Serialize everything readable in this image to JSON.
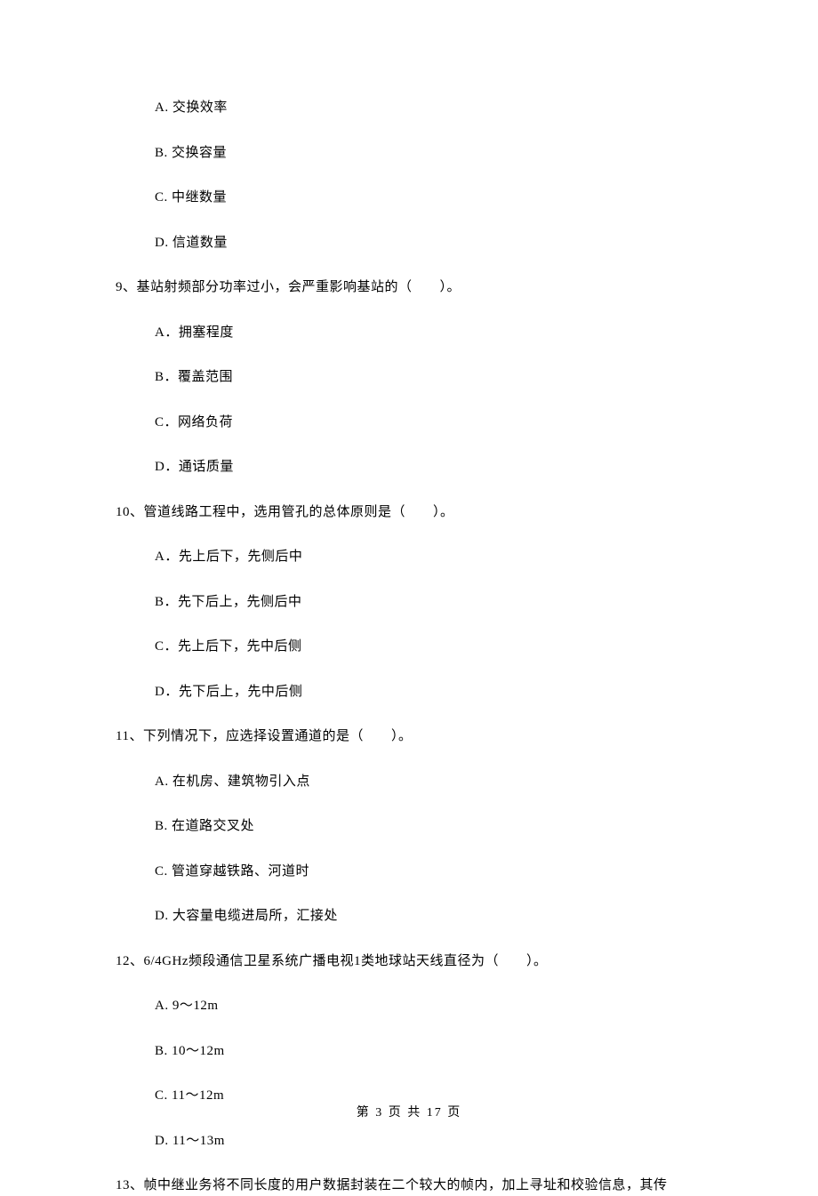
{
  "options_a": {
    "a": "A. 交换效率",
    "b": "B. 交换容量",
    "c": "C. 中继数量",
    "d": "D. 信道数量"
  },
  "q9": {
    "text": "9、基站射频部分功率过小，会严重影响基站的（　　）。",
    "a": "A．拥塞程度",
    "b": "B．覆盖范围",
    "c": "C．网络负荷",
    "d": "D．通话质量"
  },
  "q10": {
    "text": "10、管道线路工程中，选用管孔的总体原则是（　　）。",
    "a": "A．先上后下，先侧后中",
    "b": "B．先下后上，先侧后中",
    "c": "C．先上后下，先中后侧",
    "d": "D．先下后上，先中后侧"
  },
  "q11": {
    "text": "11、下列情况下，应选择设置通道的是（　　）。",
    "a": "A. 在机房、建筑物引入点",
    "b": "B. 在道路交叉处",
    "c": "C. 管道穿越铁路、河道时",
    "d": "D. 大容量电缆进局所，汇接处"
  },
  "q12": {
    "text": "12、6/4GHz频段通信卫星系统广播电视1类地球站天线直径为（　　）。",
    "a": "A. 9～12m",
    "b": "B. 10～12m",
    "c": "C. 11～12m",
    "d": "D. 11～13m"
  },
  "q13": {
    "text": "13、帧中继业务将不同长度的用户数据封装在二个较大的帧内，加上寻址和校验信息，其传"
  },
  "footer": "第 3 页 共 17 页"
}
